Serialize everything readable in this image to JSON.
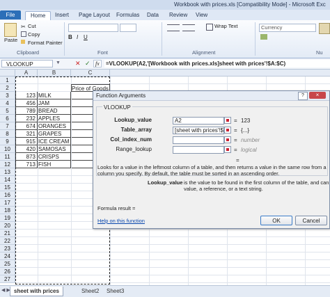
{
  "window": {
    "title": "Workbook with prices.xls [Compatibility Mode] - Microsoft Exc"
  },
  "tabs": [
    "File",
    "Home",
    "Insert",
    "Page Layout",
    "Formulas",
    "Data",
    "Review",
    "View"
  ],
  "ribbon": {
    "cut": "Cut",
    "copy": "Copy",
    "format_painter": "Format Painter",
    "paste": "Paste",
    "clipboard": "Clipboard",
    "font": "Font",
    "alignment": "Alignment",
    "number": "Nu",
    "wrap_text": "Wrap Text",
    "number_format": "Currency"
  },
  "formula_bar": {
    "name_box": "VLOOKUP",
    "fx": "fx",
    "formula": "=VLOOKUP(A2,'[Workbook with prices.xls]sheet with prices'!$A:$C)"
  },
  "grid": {
    "columns": [
      "A",
      "B",
      "C"
    ],
    "header_cell": "Price of Goods",
    "rows": [
      {
        "n": "1",
        "a": "",
        "b": ""
      },
      {
        "n": "2",
        "a": "",
        "b": ""
      },
      {
        "n": "3",
        "a": "123",
        "b": "MILK"
      },
      {
        "n": "4",
        "a": "456",
        "b": "JAM"
      },
      {
        "n": "5",
        "a": "789",
        "b": "BREAD"
      },
      {
        "n": "6",
        "a": "232",
        "b": "APPLES"
      },
      {
        "n": "7",
        "a": "674",
        "b": "ORANGES"
      },
      {
        "n": "8",
        "a": "321",
        "b": "GRAPES"
      },
      {
        "n": "9",
        "a": "915",
        "b": "ICE CREAM"
      },
      {
        "n": "10",
        "a": "420",
        "b": "SAMOSAS"
      },
      {
        "n": "11",
        "a": "873",
        "b": "CRISPS"
      },
      {
        "n": "12",
        "a": "713",
        "b": "FISH"
      },
      {
        "n": "13",
        "a": "",
        "b": ""
      },
      {
        "n": "14",
        "a": "",
        "b": ""
      },
      {
        "n": "15",
        "a": "",
        "b": ""
      },
      {
        "n": "16",
        "a": "",
        "b": ""
      },
      {
        "n": "17",
        "a": "",
        "b": ""
      },
      {
        "n": "18",
        "a": "",
        "b": ""
      },
      {
        "n": "19",
        "a": "",
        "b": ""
      },
      {
        "n": "20",
        "a": "",
        "b": ""
      },
      {
        "n": "21",
        "a": "",
        "b": ""
      },
      {
        "n": "22",
        "a": "",
        "b": ""
      },
      {
        "n": "23",
        "a": "",
        "b": ""
      },
      {
        "n": "24",
        "a": "",
        "b": ""
      },
      {
        "n": "25",
        "a": "",
        "b": ""
      },
      {
        "n": "26",
        "a": "",
        "b": ""
      },
      {
        "n": "27",
        "a": "",
        "b": ""
      }
    ]
  },
  "sheet_tabs": [
    "sheet with prices",
    "Sheet2",
    "Sheet3"
  ],
  "dialog": {
    "title": "Function Arguments",
    "help_glyph": "?",
    "close_glyph": "×",
    "function_name": "VLOOKUP",
    "args": [
      {
        "label": "Lookup_value",
        "value": "A2",
        "result": "123"
      },
      {
        "label": "Table_array",
        "value": "[sheet with prices'!$A:$C",
        "result": "{...}"
      },
      {
        "label": "Col_index_num",
        "value": "",
        "result": "number"
      },
      {
        "label": "Range_lookup",
        "value": "",
        "result": "logical"
      }
    ],
    "equals": "=",
    "description": "Looks for a value in the leftmost column of a table, and then returns a value in the same row from a column you specify. By default, the table must be sorted in an ascending order.",
    "detail_label": "Lookup_value",
    "detail_text_1": "is the value to be found in the first column of the table, and can be a",
    "detail_text_2": "value, a reference, or a text string.",
    "formula_result": "Formula result =",
    "help_link": "Help on this function",
    "ok": "OK",
    "cancel": "Cancel"
  },
  "colors": {
    "accent": "#2c6fb8",
    "ribbon": "#dfe8f5",
    "dialog_bg": "#f0f0f0",
    "link": "#0645ad"
  }
}
